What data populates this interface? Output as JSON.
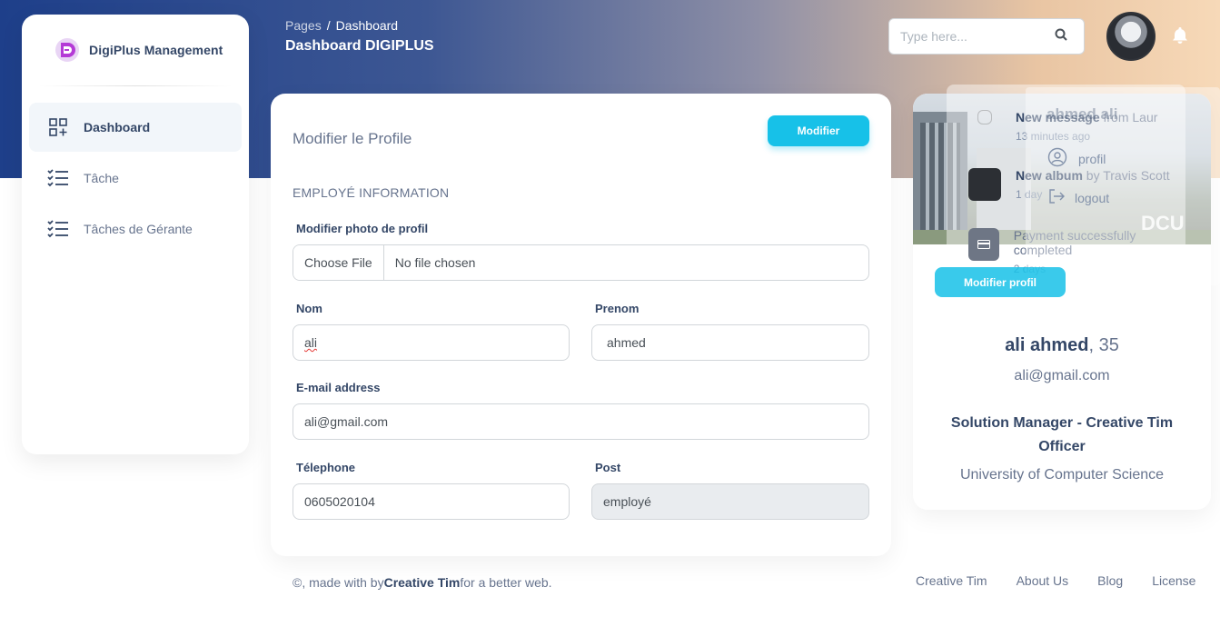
{
  "brand": {
    "name": "DigiPlus Management"
  },
  "sidebar": {
    "items": [
      {
        "label": "Dashboard",
        "icon": "dashboard-grid-icon",
        "active": true
      },
      {
        "label": "Tâche",
        "icon": "checklist-icon",
        "active": false
      },
      {
        "label": "Tâches de Gérante",
        "icon": "checklist-icon",
        "active": false
      }
    ]
  },
  "header": {
    "breadcrumb_root": "Pages",
    "breadcrumb_sep": "/",
    "breadcrumb_current": "Dashboard",
    "title": "Dashboard DIGIPLUS",
    "search_placeholder": "Type here..."
  },
  "form": {
    "title": "Modifier le Profile",
    "submit_label": "Modifier",
    "section": "EMPLOYÉ INFORMATION",
    "photo_label": "Modifier photo de profil",
    "file_button": "Choose File",
    "file_status": "No file chosen",
    "nom_label": "Nom",
    "nom_value": "ali",
    "prenom_label": "Prenom",
    "prenom_value": "ahmed",
    "email_label": "E-mail address",
    "email_value": "ali@gmail.com",
    "tel_label": "Télephone",
    "tel_value": "0605020104",
    "post_label": "Post",
    "post_value": "employé"
  },
  "profile": {
    "name": "ali ahmed",
    "age": ", 35",
    "email": "ali@gmail.com",
    "role": "Solution Manager - Creative Tim Officer",
    "university": "University of Computer Science",
    "button_label": "Modifier profil",
    "ghost_title": "ahmed ali",
    "image_text": "DCU"
  },
  "notifications": [
    {
      "bold": "New message",
      "rest": " from Laur",
      "time": "13 minutes ago"
    },
    {
      "bold": "New album",
      "rest": " by Travis Scott",
      "time": "1 day"
    },
    {
      "bold": "",
      "rest": "Payment successfully completed",
      "time": "2 days"
    }
  ],
  "user_menu": [
    {
      "label": "profil",
      "icon": "user-circle-icon"
    },
    {
      "label": "logout",
      "icon": "logout-icon"
    }
  ],
  "footer": {
    "prefix": "©, made with by",
    "brand": "Creative Tim",
    "suffix": "for a better web.",
    "links": [
      "Creative Tim",
      "About Us",
      "Blog",
      "License"
    ]
  },
  "colors": {
    "accent": "#17c1e8",
    "text_dark": "#344767",
    "text_muted": "#67748e",
    "hero_start": "#1e3f8a",
    "hero_end": "#f7d9b8"
  }
}
